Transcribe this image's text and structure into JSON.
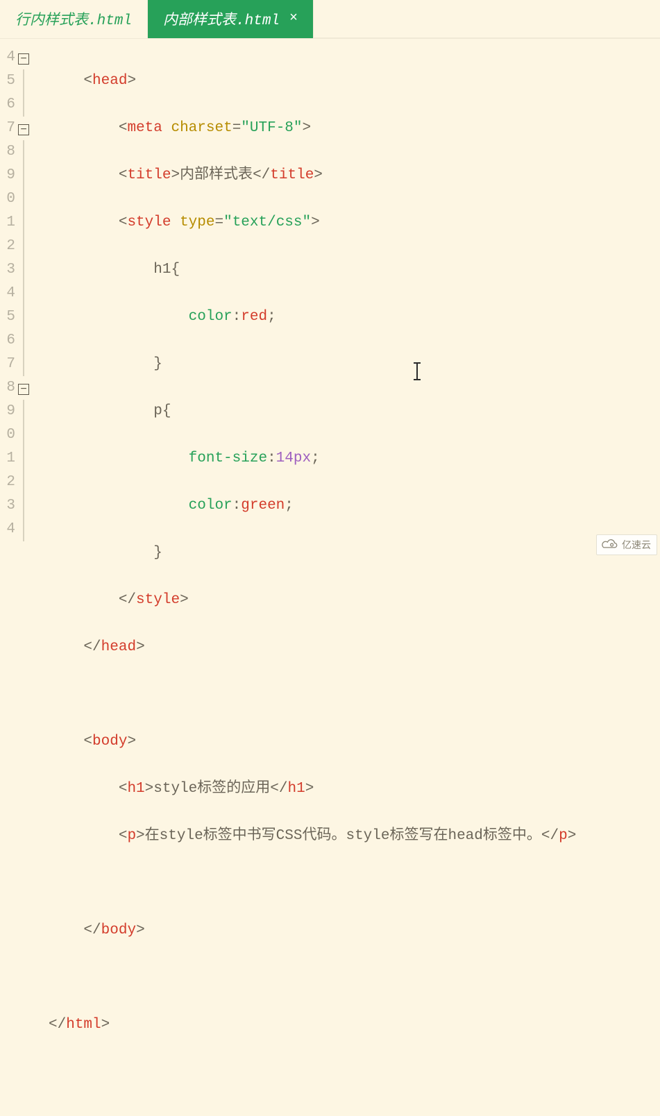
{
  "tabs": {
    "inactive": "行内样式表.html",
    "active": "内部样式表.html"
  },
  "line_numbers": [
    "4",
    "5",
    "6",
    "7",
    "8",
    "9",
    "0",
    "1",
    "2",
    "3",
    "4",
    "5",
    "6",
    "7",
    "8",
    "9",
    "0",
    "1",
    "2",
    "3",
    "4"
  ],
  "fold_markers": {
    "l4": "−",
    "l7": "−",
    "l18": "−"
  },
  "code": {
    "head_open": "head",
    "meta": {
      "tag": "meta",
      "attr": "charset",
      "val": "\"UTF-8\""
    },
    "title": {
      "tag": "title",
      "text": "内部样式表"
    },
    "style_open": {
      "tag": "style",
      "attr": "type",
      "val": "\"text/css\""
    },
    "h1_sel": "h1{",
    "h1_color": {
      "prop": "color",
      "val": "red"
    },
    "close_brace1": "}",
    "p_sel": "p{",
    "p_fs": {
      "prop": "font-size",
      "num": "14px"
    },
    "p_color": {
      "prop": "color",
      "val": "green"
    },
    "close_brace2": "}",
    "style_close": "style",
    "head_close": "head",
    "body_open": "body",
    "h1": {
      "tag": "h1",
      "text": "style标签的应用"
    },
    "p": {
      "tag": "p",
      "text": "在style标签中书写CSS代码。style标签写在head标签中。"
    },
    "body_close": "body",
    "html_close": "html"
  },
  "watermark": "亿速云"
}
